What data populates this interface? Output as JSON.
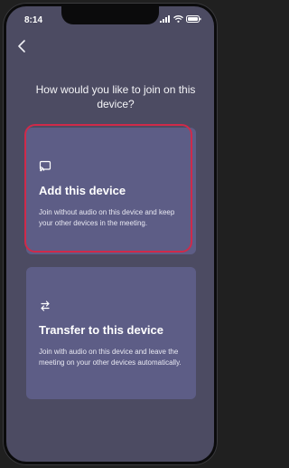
{
  "status_bar": {
    "time": "8:14",
    "icons": [
      "cellular-signal-icon",
      "wifi-icon",
      "battery-icon"
    ]
  },
  "back_icon": "chevron-left-icon",
  "prompt": "How would you like to join on this device?",
  "options": [
    {
      "icon": "cast-device-icon",
      "title": "Add this device",
      "description": "Join without audio on this device and keep your other devices in the meeting.",
      "highlighted": true
    },
    {
      "icon": "transfer-arrows-icon",
      "title": "Transfer to this device",
      "description": "Join with audio on this device and leave the meeting on your other devices automatically.",
      "highlighted": false
    }
  ],
  "colors": {
    "background": "#4c4b62",
    "card": "#5d5d86",
    "highlight": "#cf2a4a",
    "text": "#ffffff"
  }
}
